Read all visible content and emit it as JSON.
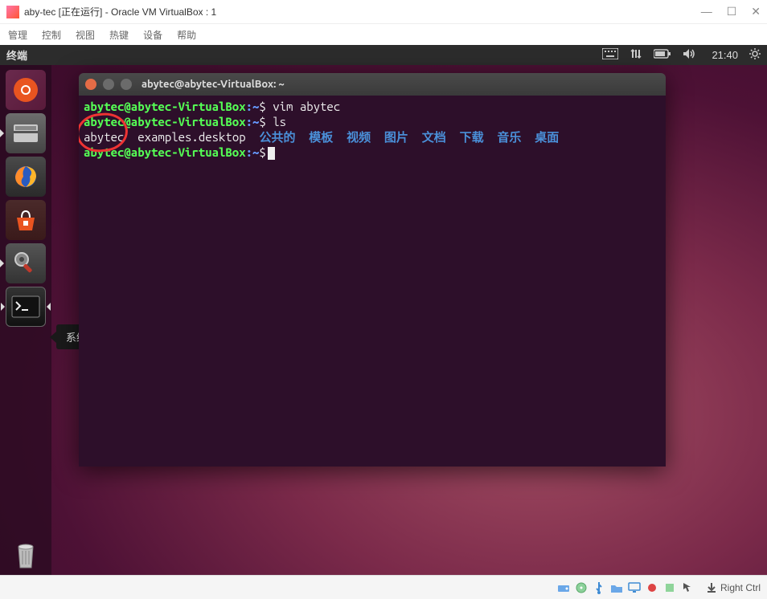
{
  "vbox": {
    "title": "aby-tec [正在运行] - Oracle VM VirtualBox : 1",
    "menu": {
      "manage": "管理",
      "control": "控制",
      "view": "视图",
      "hotkeys": "热键",
      "devices": "设备",
      "help": "帮助"
    },
    "win": {
      "min": "—",
      "max": "☐",
      "close": "✕"
    },
    "hostkey": "Right Ctrl"
  },
  "panel": {
    "app_title": "终端",
    "time": "21:40"
  },
  "tooltip": {
    "settings": "系统设置"
  },
  "terminal": {
    "title": "abytec@abytec-VirtualBox: ~",
    "prompt": {
      "userhost": "abytec@abytec-VirtualBox",
      "sep": ":",
      "path": "~",
      "sym": "$"
    },
    "lines": {
      "cmd1": "vim abytec",
      "cmd2": "ls",
      "ls": {
        "f1": "abytec",
        "f2": "examples.desktop",
        "d1": "公共的",
        "d2": "模板",
        "d3": "视频",
        "d4": "图片",
        "d5": "文档",
        "d6": "下载",
        "d7": "音乐",
        "d8": "桌面"
      }
    }
  }
}
